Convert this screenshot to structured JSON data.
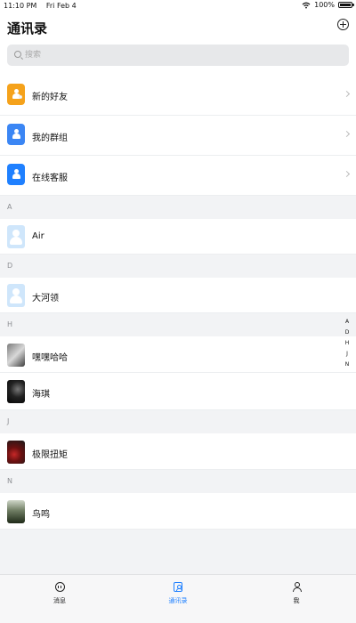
{
  "status": {
    "time": "11:10 PM",
    "date": "Fri Feb 4",
    "battery": "100%",
    "battery_level": 1.0
  },
  "header": {
    "title": "通讯录",
    "add_icon": "add-circle-icon"
  },
  "search": {
    "placeholder": "搜索",
    "value": ""
  },
  "menu": [
    {
      "label": "新的好友",
      "icon": "new-friend-icon",
      "color": "#f5a21b"
    },
    {
      "label": "我的群组",
      "icon": "my-groups-icon",
      "color": "#3b86f4"
    },
    {
      "label": "在线客服",
      "icon": "customer-service-icon",
      "color": "#1f80ff"
    }
  ],
  "sections": [
    {
      "letter": "A",
      "contacts": [
        {
          "name": "Air",
          "avatar": "default-avatar"
        }
      ]
    },
    {
      "letter": "D",
      "contacts": [
        {
          "name": "大河领",
          "avatar": "default-avatar"
        }
      ]
    },
    {
      "letter": "H",
      "contacts": [
        {
          "name": "嘿嘿哈哈",
          "avatar": "photo-avatar"
        },
        {
          "name": "海琪",
          "avatar": "photo-avatar"
        }
      ]
    },
    {
      "letter": "J",
      "contacts": [
        {
          "name": "极限扭矩",
          "avatar": "photo-avatar"
        }
      ]
    },
    {
      "letter": "N",
      "contacts": [
        {
          "name": "鸟鸣",
          "avatar": "photo-avatar"
        }
      ]
    }
  ],
  "index_letters": [
    "A",
    "D",
    "H",
    "J",
    "N"
  ],
  "tabs": [
    {
      "label": "消息",
      "icon": "message-icon",
      "active": false
    },
    {
      "label": "通讯录",
      "icon": "contacts-icon",
      "active": true
    },
    {
      "label": "我",
      "icon": "profile-icon",
      "active": false
    }
  ],
  "colors": {
    "accent": "#1f80ff",
    "background": "#f2f3f5",
    "separator": "#eceef0"
  }
}
